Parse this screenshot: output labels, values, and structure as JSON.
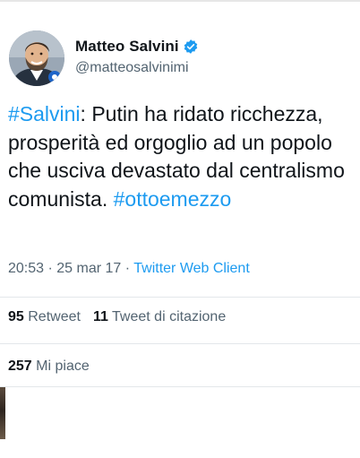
{
  "tweet": {
    "display_name": "Matteo Salvini",
    "handle": "@matteosalvinimi",
    "text": {
      "hashtag1": "#Salvini",
      "body": ": Putin ha ridato ricchezza, prosperità ed orgoglio ad un popolo che usciva devastato dal centralismo comunista. ",
      "hashtag2": "#ottoemezzo"
    },
    "time": "20:53",
    "separator": " · ",
    "date": "25 mar 17",
    "client": "Twitter Web Client"
  },
  "stats": {
    "retweets_count": "95",
    "retweets_label": "Retweet",
    "quotes_count": "11",
    "quotes_label": "Tweet di citazione",
    "likes_count": "257",
    "likes_label": "Mi piace"
  },
  "icons": {
    "verified": "verified-badge-icon",
    "avatar": "avatar"
  },
  "colors": {
    "link": "#1d9bf0",
    "secondary_text": "#536471",
    "primary_text": "#0f1419"
  }
}
